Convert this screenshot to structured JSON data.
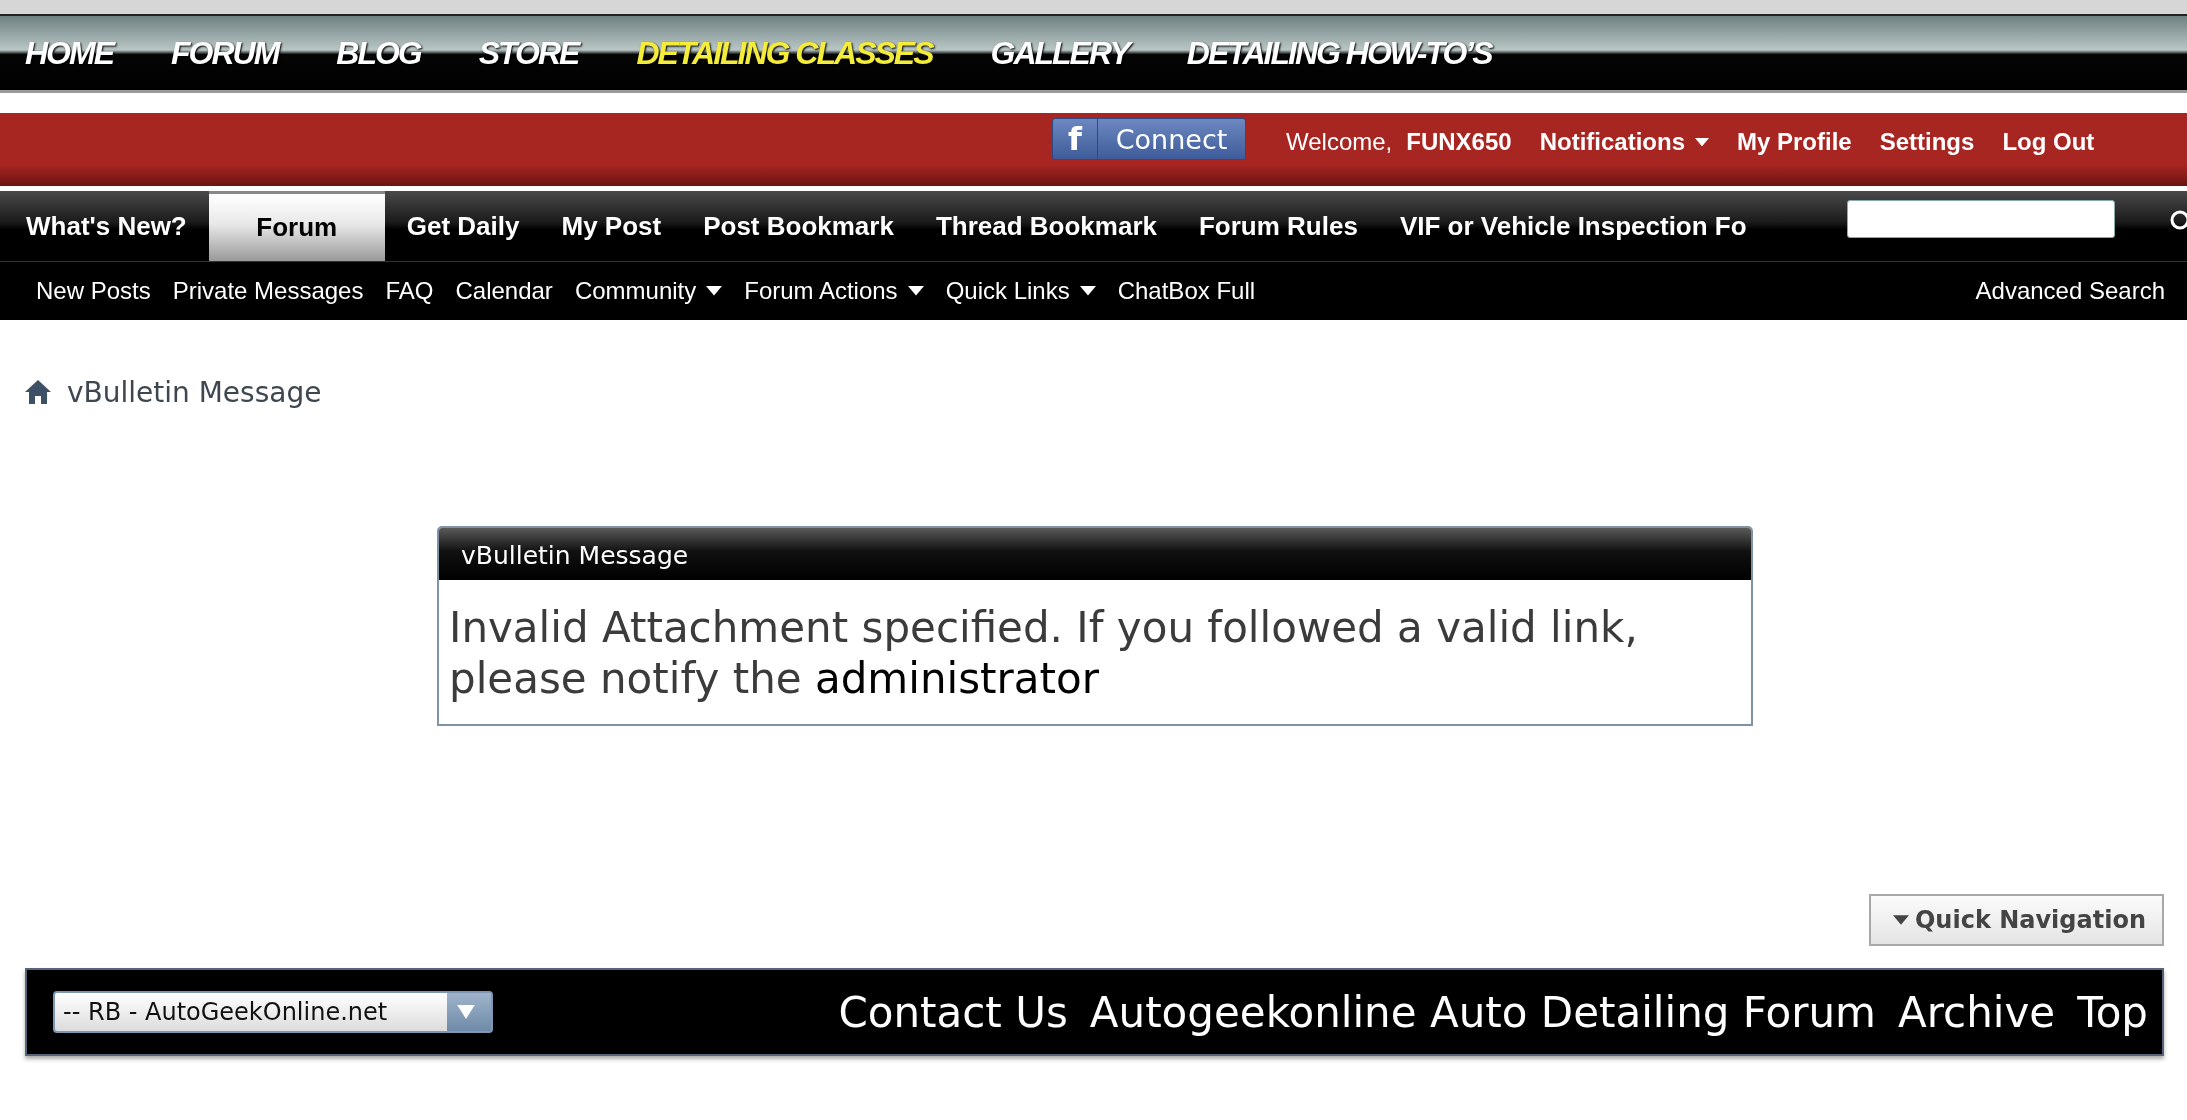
{
  "banner_nav": [
    {
      "label": "HOME",
      "highlighted": false
    },
    {
      "label": "FORUM",
      "highlighted": false
    },
    {
      "label": "BLOG",
      "highlighted": false
    },
    {
      "label": "STORE",
      "highlighted": false
    },
    {
      "label": "DETAILING CLASSES",
      "highlighted": true
    },
    {
      "label": "GALLERY",
      "highlighted": false
    },
    {
      "label": "DETAILING HOW-TO’S",
      "highlighted": false
    }
  ],
  "user_bar": {
    "facebook_icon": "f",
    "facebook_button": "Connect",
    "welcome": "Welcome,",
    "username": "FUNX650",
    "links": [
      {
        "label": "Notifications",
        "dropdown": true
      },
      {
        "label": "My Profile",
        "dropdown": false
      },
      {
        "label": "Settings",
        "dropdown": false
      },
      {
        "label": "Log Out",
        "dropdown": false
      }
    ]
  },
  "tabs": [
    {
      "label": "What's New?",
      "selected": false
    },
    {
      "label": "Forum",
      "selected": true
    },
    {
      "label": "Get Daily",
      "selected": false
    },
    {
      "label": "My Post",
      "selected": false
    },
    {
      "label": "Post Bookmark",
      "selected": false
    },
    {
      "label": "Thread Bookmark",
      "selected": false
    },
    {
      "label": "Forum Rules",
      "selected": false
    },
    {
      "label": "VIF or Vehicle Inspection Fo",
      "selected": false
    }
  ],
  "subnav": {
    "links": [
      {
        "label": "New Posts",
        "dropdown": false
      },
      {
        "label": "Private Messages",
        "dropdown": false
      },
      {
        "label": "FAQ",
        "dropdown": false
      },
      {
        "label": "Calendar",
        "dropdown": false
      },
      {
        "label": "Community",
        "dropdown": true
      },
      {
        "label": "Forum Actions",
        "dropdown": true
      },
      {
        "label": "Quick Links",
        "dropdown": true
      },
      {
        "label": "ChatBox Full",
        "dropdown": false
      }
    ],
    "advanced_search": "Advanced Search"
  },
  "breadcrumb": "vBulletin Message",
  "message": {
    "title": "vBulletin Message",
    "text": "Invalid Attachment specified. If you followed a valid link, please notify the",
    "link": "administrator"
  },
  "quick_navigation": "Quick Navigation",
  "footer": {
    "style_select": "-- RB - AutoGeekOnline.net",
    "links": [
      "Contact Us",
      "Autogeekonline Auto Detailing Forum",
      "Archive",
      "Top"
    ]
  }
}
